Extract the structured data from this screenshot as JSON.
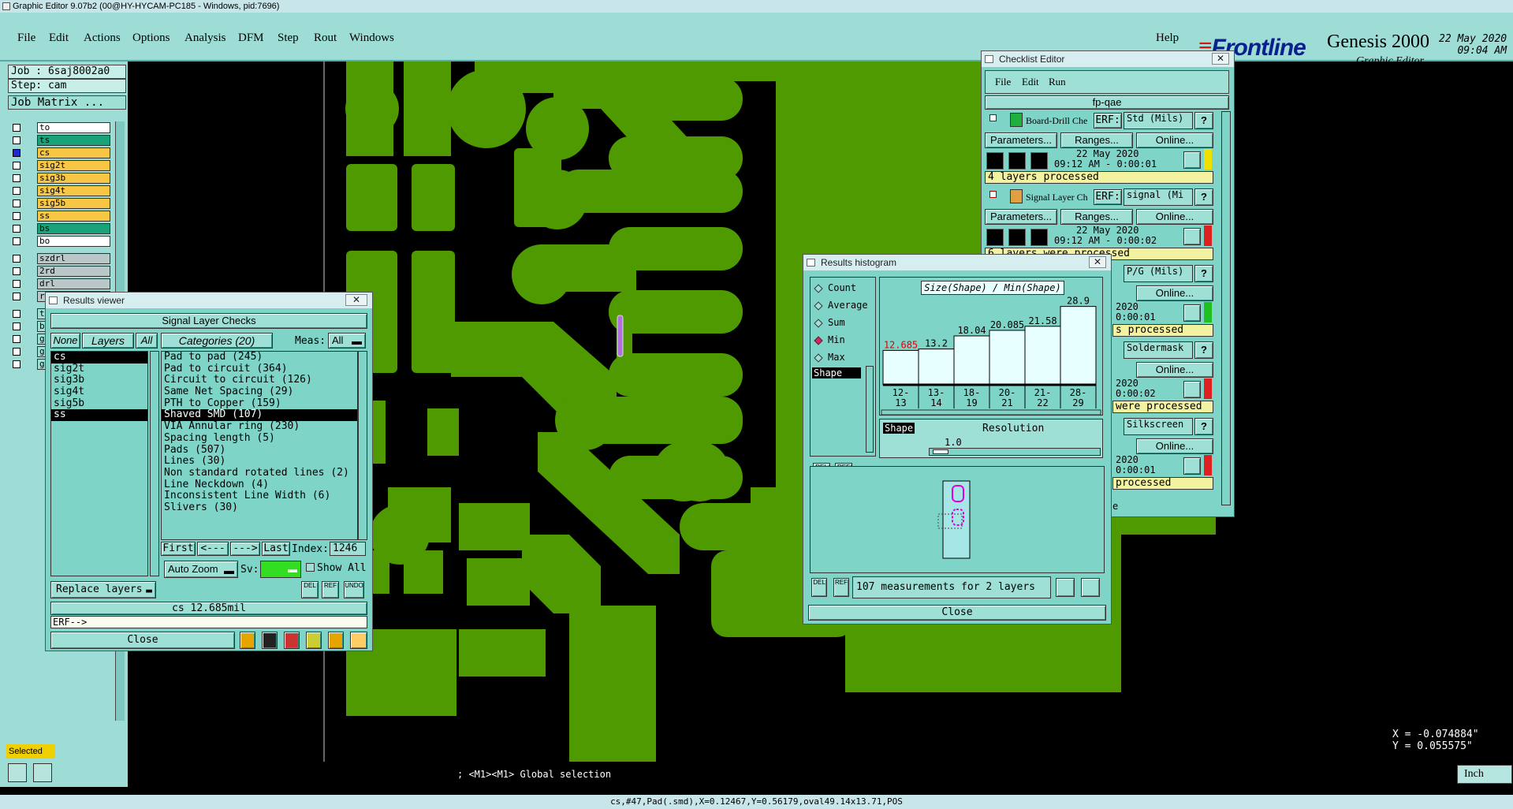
{
  "window": {
    "title": "Graphic Editor 9.07b2 (00@HY-HYCAM-PC185 - Windows, pid:7696)"
  },
  "menu": [
    "File",
    "Edit",
    "Actions",
    "Options",
    "Analysis",
    "DFM",
    "Step",
    "Rout",
    "Windows"
  ],
  "help": "Help",
  "brand": {
    "logo": "Frontline",
    "product": "Genesis 2000",
    "subtitle": "Graphic Editor",
    "date": "22 May 2020",
    "time": "09:04 AM"
  },
  "job": {
    "job": "Job : 6saj8002a0",
    "step": "Step: cam",
    "matrix": "Job Matrix ..."
  },
  "layers": [
    {
      "name": "to",
      "color": "#ffffff"
    },
    {
      "name": "ts",
      "color": "#1aa37a"
    },
    {
      "name": "cs",
      "color": "#f6c644"
    },
    {
      "name": "sig2t",
      "color": "#f6c644"
    },
    {
      "name": "sig3b",
      "color": "#f6c644"
    },
    {
      "name": "sig4t",
      "color": "#f6c644"
    },
    {
      "name": "sig5b",
      "color": "#f6c644"
    },
    {
      "name": "ss",
      "color": "#f6c644"
    },
    {
      "name": "bs",
      "color": "#1aa37a"
    },
    {
      "name": "bo",
      "color": "#ffffff"
    },
    {
      "name": "szdrl",
      "color": "#b9c7c9"
    },
    {
      "name": "2rd",
      "color": "#b9c7c9"
    },
    {
      "name": "drl",
      "color": "#b9c7c9"
    },
    {
      "name": "rout",
      "color": "#b9c7c9"
    },
    {
      "name": "tp",
      "color": "#9ee0d6"
    },
    {
      "name": "bp",
      "color": "#9ee0d6"
    },
    {
      "name": "gdl",
      "color": "#9ee0d6"
    },
    {
      "name": "ggl",
      "color": "#9ee0d6"
    },
    {
      "name": "gml",
      "color": "#9ee0d6"
    }
  ],
  "status": {
    "selected": "Selected",
    "global": "; <M1><M1> Global selection",
    "bottom": "cs,#47,Pad(.smd),X=0.12467,Y=0.56179,oval49.14x13.71,POS",
    "units": "Inch",
    "x": "X = -0.074884\"",
    "y": "Y =  0.055575\""
  },
  "results_viewer": {
    "title": "Results viewer",
    "header": "Signal Layer Checks",
    "none": "None",
    "layers": "Layers",
    "all": "All",
    "categories": "Categories (20)",
    "meas_label": "Meas:",
    "meas_value": "All",
    "layer_items": [
      "cs",
      "sig2t",
      "sig3b",
      "sig4t",
      "sig5b",
      "ss"
    ],
    "category_items": [
      "Pad to pad (245)",
      "Pad to circuit (364)",
      "Circuit to circuit (126)",
      "Same Net Spacing (29)",
      "PTH to Copper (159)",
      "Shaved SMD (107)",
      "VIA Annular ring (230)",
      "Spacing length (5)",
      "Pads (507)",
      "Lines (30)",
      "Non standard rotated lines (2)",
      "Line Neckdown (4)",
      "Inconsistent Line Width (6)",
      "Slivers (30)"
    ],
    "first": "First",
    "prev": "<---",
    "next": "--->",
    "last": "Last",
    "index_label": "Index:",
    "index_value": "1246",
    "auto_zoom": "Auto Zoom",
    "sv": "Sv:",
    "show_all": "Show All",
    "replace": "Replace layers",
    "result": "cs 12.685mil",
    "erf": "ERF-->",
    "close": "Close"
  },
  "checklist": {
    "title": "Checklist Editor",
    "menu": [
      "File",
      "Edit",
      "Run"
    ],
    "name": "fp-qae",
    "blocks": [
      {
        "label": "Board-Drill Che",
        "erf": "ERF:",
        "erf_value": "Std (Mils)",
        "date": "22 May 2020",
        "time": "09:12 AM - 0:00:01",
        "status": "4 layers processed",
        "flag": "#f0e000"
      },
      {
        "label": "Signal Layer Ch",
        "erf": "ERF:",
        "erf_value": "signal (Mi",
        "date": "22 May 2020",
        "time": "09:12 AM - 0:00:02",
        "status": "6 layers were processed",
        "flag": "#e02020"
      }
    ],
    "partial": [
      {
        "erf_value": "P/G (Mils)",
        "date": "2020",
        "time": "0:00:01",
        "status": "s processed",
        "flag": "#20c020"
      },
      {
        "erf_value": "Soldermask",
        "date": "2020",
        "time": "0:00:02",
        "status": "were processed",
        "flag": "#e02020"
      },
      {
        "erf_value": "Silkscreen",
        "date": "2020",
        "time": "0:00:01",
        "status": "processed",
        "flag": "#e02020"
      }
    ],
    "parameters": "Parameters...",
    "ranges": "Ranges...",
    "online": "Online...",
    "help_btn": "?",
    "tail": "e"
  },
  "histogram": {
    "title": "Results histogram",
    "options": [
      "Count",
      "Average",
      "Sum",
      "Min",
      "Max"
    ],
    "selected_option": "Min",
    "chart_title": "Size(Shape) / Min(Shape)",
    "shape": "Shape",
    "resolution_label": "Resolution",
    "resolution_value": "1.0",
    "footer": "107 measurements for 2 layers",
    "close": "Close"
  },
  "chart_data": {
    "type": "bar",
    "title": "Size(Shape) / Min(Shape)",
    "categories": [
      "12-13",
      "13-14",
      "18-19",
      "20-21",
      "21-22",
      "28-29"
    ],
    "values": [
      12.685,
      13.2,
      18.04,
      20.085,
      21.58,
      28.9
    ],
    "value_labels": [
      "12.685",
      "13.2",
      "18.04",
      "20.085",
      "21.58",
      "28.9"
    ],
    "highlight_index": 0,
    "colors": {
      "bar": "#e8ffff",
      "highlight_label": "#e00000"
    }
  },
  "colors": {
    "copper": "#4e9a00",
    "panel": "#9edcd6",
    "accent_purple": "#b070e0"
  }
}
